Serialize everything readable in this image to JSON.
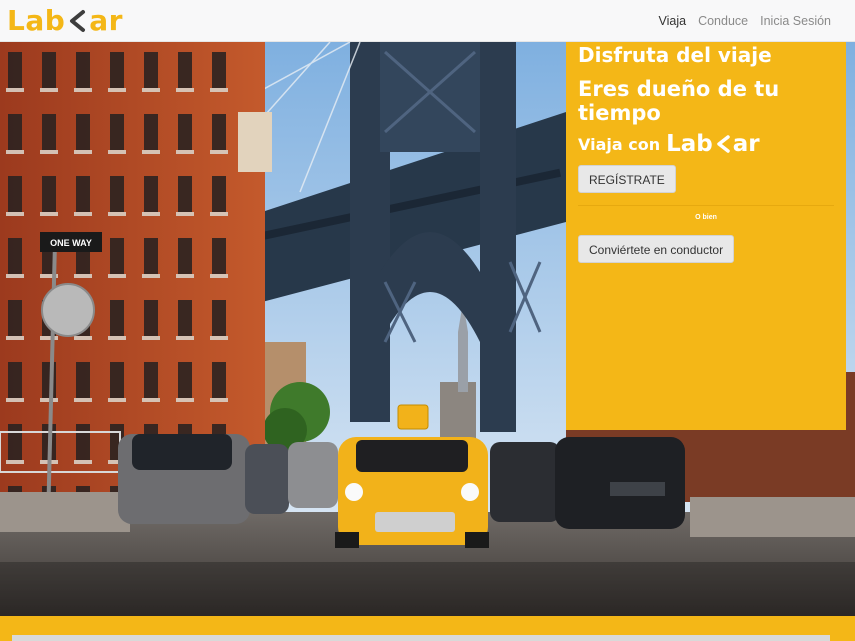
{
  "navbar": {
    "brand_prefix": "Lab",
    "brand_suffix": "ar",
    "links": [
      {
        "label": "Viaja",
        "active": true
      },
      {
        "label": "Conduce",
        "active": false
      },
      {
        "label": "Inicia Sesión",
        "active": false
      }
    ]
  },
  "hero": {
    "street_sign": "ONE WAY"
  },
  "panel": {
    "headline_1": "Disfruta del viaje",
    "headline_2": "Eres dueño de tu tiempo",
    "tagline_prefix": "Viaja con",
    "brand_prefix": "Lab",
    "brand_suffix": "ar",
    "register_button": "REGÍSTRATE",
    "or_text": "O bien",
    "driver_button": "Conviértete en conductor"
  },
  "colors": {
    "accent": "#f4b717",
    "nav_background": "#f8f8f9",
    "button_background": "#e8e8e8"
  }
}
